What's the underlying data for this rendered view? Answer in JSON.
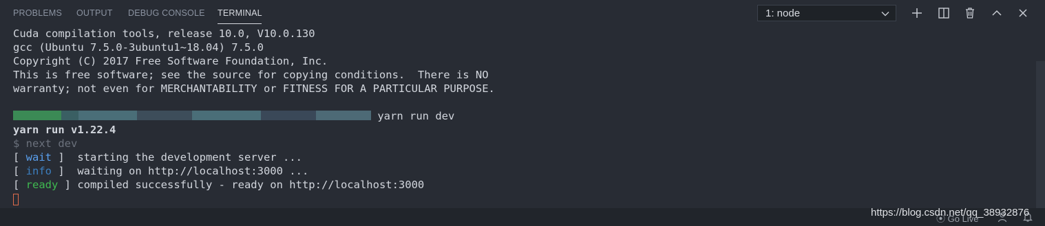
{
  "tabs": [
    {
      "label": "PROBLEMS"
    },
    {
      "label": "OUTPUT"
    },
    {
      "label": "DEBUG CONSOLE"
    },
    {
      "label": "TERMINAL"
    }
  ],
  "terminal_select": {
    "value": "1: node"
  },
  "toolbar_icons": [
    "plus-icon",
    "split-icon",
    "trash-icon",
    "chevron-up-icon",
    "close-icon"
  ],
  "terminal": {
    "lines": [
      "Cuda compilation tools, release 10.0, V10.0.130",
      "gcc (Ubuntu 7.5.0-3ubuntu1~18.04) 7.5.0",
      "Copyright (C) 2017 Free Software Foundation, Inc.",
      "This is free software; see the source for copying conditions.  There is NO",
      "warranty; not even for MERCHANTABILITY or FITNESS FOR A PARTICULAR PURPOSE."
    ],
    "prompt_command": " yarn run dev",
    "yarn_version": "yarn run v1.22.4",
    "next_cmd": "$ next dev",
    "log": [
      {
        "tag": "wait",
        "text": "  starting the development server ..."
      },
      {
        "tag": "info",
        "text": "  waiting on http://localhost:3000 ..."
      },
      {
        "tag": "ready",
        "text": " compiled successfully - ready on http://localhost:3000"
      }
    ],
    "bracket_open": "[ ",
    "bracket_close": " ]"
  },
  "statusbar": {
    "go_live": "Go Live"
  },
  "watermark": "https://blog.csdn.net/qq_38932876",
  "colors": {
    "background": "#282c34",
    "wait": "#5aa0ef",
    "info": "#3c7fc0",
    "ready": "#3fb950",
    "cursor": "#e06c4c"
  }
}
